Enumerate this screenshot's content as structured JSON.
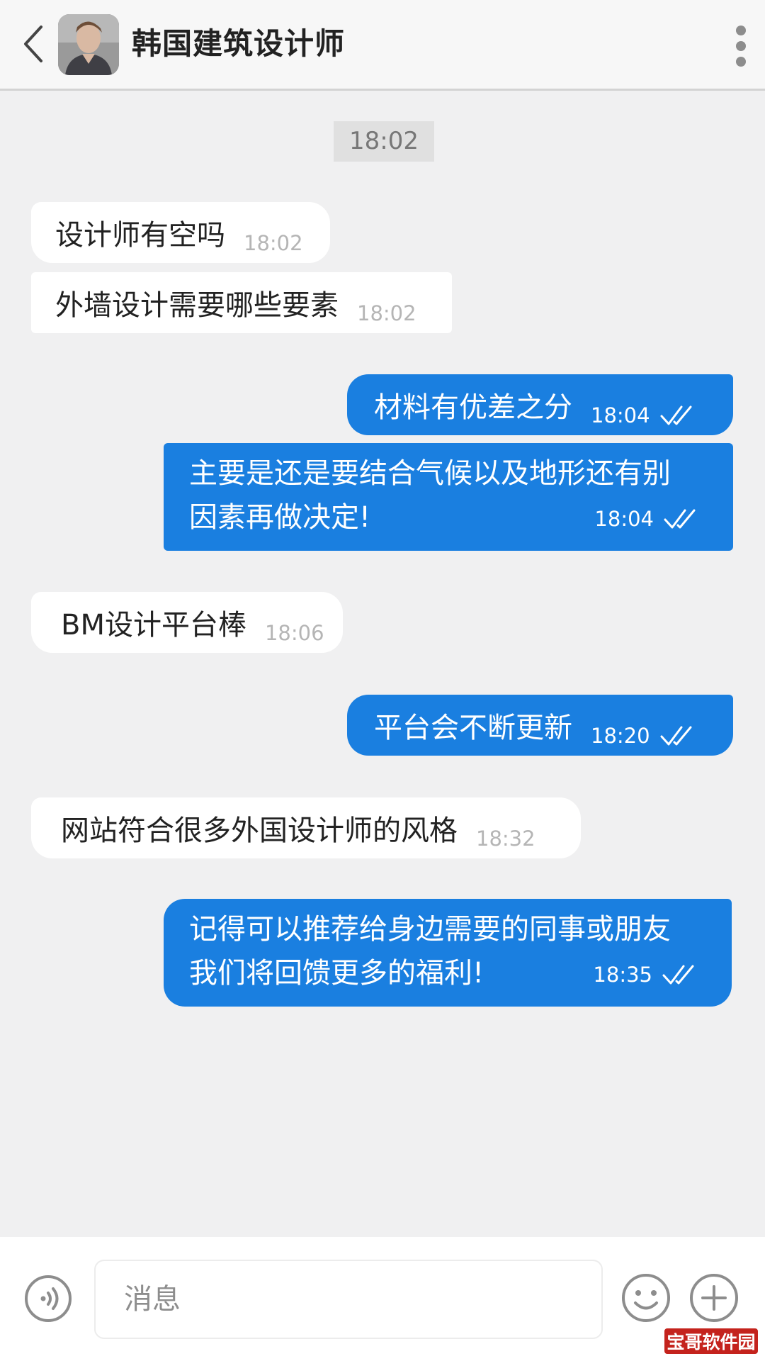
{
  "header": {
    "title": "韩国建筑设计师",
    "back_icon": "chevron-left-icon",
    "more_icon": "more-vertical-icon"
  },
  "date_chip": "18:02",
  "messages": [
    {
      "direction": "incoming",
      "text": "设计师有空吗",
      "time": "18:02"
    },
    {
      "direction": "incoming",
      "text": "外墙设计需要哪些要素",
      "time": "18:02"
    },
    {
      "direction": "outgoing",
      "text": "材料有优差之分",
      "time": "18:04",
      "status": "read"
    },
    {
      "direction": "outgoing",
      "lines": [
        "主要是还是要结合气候以及地形还有别",
        "因素再做决定!"
      ],
      "time": "18:04",
      "status": "read"
    },
    {
      "direction": "incoming",
      "text": "BM设计平台棒",
      "time": "18:06"
    },
    {
      "direction": "outgoing",
      "text": "平台会不断更新",
      "time": "18:20",
      "status": "read"
    },
    {
      "direction": "incoming",
      "text": "网站符合很多外国设计师的风格",
      "time": "18:32"
    },
    {
      "direction": "outgoing",
      "lines": [
        "记得可以推荐给身边需要的同事或朋友",
        "我们将回馈更多的福利!"
      ],
      "time": "18:35",
      "status": "read"
    }
  ],
  "composer": {
    "placeholder": "消息",
    "voice_icon": "voice-icon",
    "emoji_icon": "emoji-icon",
    "plus_icon": "plus-icon"
  },
  "watermark": "宝哥软件园",
  "colors": {
    "outgoing_bubble": "#1a7fe0",
    "incoming_bubble": "#ffffff",
    "background": "#f0f0f1"
  }
}
